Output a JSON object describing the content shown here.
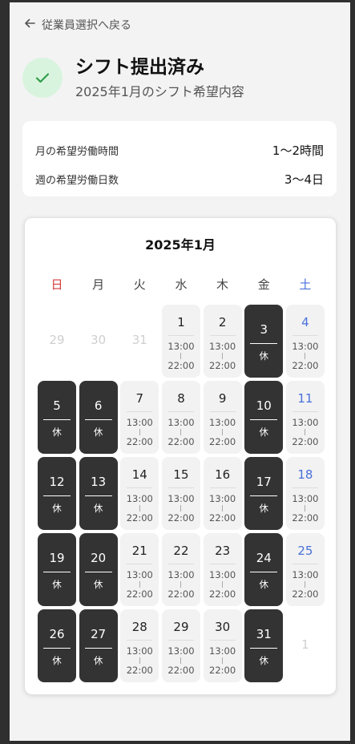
{
  "nav": {
    "back_label": "従業員選択へ戻る"
  },
  "header": {
    "title": "シフト提出済み",
    "subtitle": "2025年1月のシフト希望内容"
  },
  "summary": {
    "monthly_hours_label": "月の希望労働時間",
    "monthly_hours_value": "1〜2時間",
    "weekly_days_label": "週の希望労働日数",
    "weekly_days_value": "3〜4日"
  },
  "calendar": {
    "title": "2025年1月",
    "weekdays": [
      "日",
      "月",
      "火",
      "水",
      "木",
      "金",
      "土"
    ],
    "off_label": "休",
    "days": [
      {
        "n": "29",
        "t": "empty"
      },
      {
        "n": "30",
        "t": "empty"
      },
      {
        "n": "31",
        "t": "empty"
      },
      {
        "n": "1",
        "t": "work",
        "s": "13:00",
        "e": "22:00"
      },
      {
        "n": "2",
        "t": "work",
        "s": "13:00",
        "e": "22:00"
      },
      {
        "n": "3",
        "t": "off"
      },
      {
        "n": "4",
        "t": "work",
        "s": "13:00",
        "e": "22:00",
        "sat": true
      },
      {
        "n": "5",
        "t": "off"
      },
      {
        "n": "6",
        "t": "off"
      },
      {
        "n": "7",
        "t": "work",
        "s": "13:00",
        "e": "22:00"
      },
      {
        "n": "8",
        "t": "work",
        "s": "13:00",
        "e": "22:00"
      },
      {
        "n": "9",
        "t": "work",
        "s": "13:00",
        "e": "22:00"
      },
      {
        "n": "10",
        "t": "off"
      },
      {
        "n": "11",
        "t": "work",
        "s": "13:00",
        "e": "22:00",
        "sat": true
      },
      {
        "n": "12",
        "t": "off"
      },
      {
        "n": "13",
        "t": "off"
      },
      {
        "n": "14",
        "t": "work",
        "s": "13:00",
        "e": "22:00"
      },
      {
        "n": "15",
        "t": "work",
        "s": "13:00",
        "e": "22:00"
      },
      {
        "n": "16",
        "t": "work",
        "s": "13:00",
        "e": "22:00"
      },
      {
        "n": "17",
        "t": "off"
      },
      {
        "n": "18",
        "t": "work",
        "s": "13:00",
        "e": "22:00",
        "sat": true
      },
      {
        "n": "19",
        "t": "off"
      },
      {
        "n": "20",
        "t": "off"
      },
      {
        "n": "21",
        "t": "work",
        "s": "13:00",
        "e": "22:00"
      },
      {
        "n": "22",
        "t": "work",
        "s": "13:00",
        "e": "22:00"
      },
      {
        "n": "23",
        "t": "work",
        "s": "13:00",
        "e": "22:00"
      },
      {
        "n": "24",
        "t": "off"
      },
      {
        "n": "25",
        "t": "work",
        "s": "13:00",
        "e": "22:00",
        "sat": true
      },
      {
        "n": "26",
        "t": "off"
      },
      {
        "n": "27",
        "t": "off"
      },
      {
        "n": "28",
        "t": "work",
        "s": "13:00",
        "e": "22:00"
      },
      {
        "n": "29",
        "t": "work",
        "s": "13:00",
        "e": "22:00"
      },
      {
        "n": "30",
        "t": "work",
        "s": "13:00",
        "e": "22:00"
      },
      {
        "n": "31",
        "t": "off"
      },
      {
        "n": "1",
        "t": "empty"
      }
    ]
  },
  "colors": {
    "sunday": "#d33b3b",
    "saturday": "#4a70d9",
    "off_day": "#333333",
    "success": "#2e9e4a"
  }
}
